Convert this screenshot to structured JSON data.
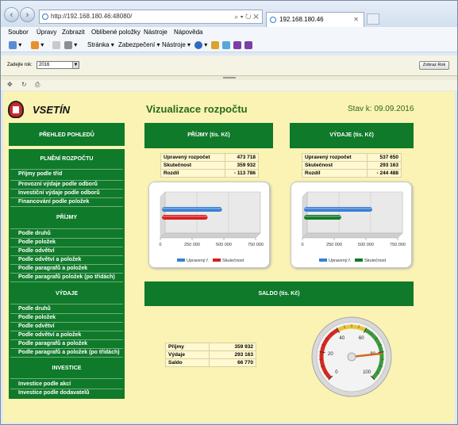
{
  "browser": {
    "address": "http://192.168.180.46:48080/",
    "address_tools": "⌕ ▾ ↻ ✕",
    "tab_title": "192.168.180.46",
    "menu": [
      "Soubor",
      "Úpravy",
      "Zobrazit",
      "Oblíbené položky",
      "Nástroje",
      "Nápověda"
    ],
    "commands": [
      "Stránka ▾",
      "Zabezpečení ▾",
      "Nástroje ▾"
    ]
  },
  "filter": {
    "label": "Zadejte rok:",
    "year": "2016",
    "button": "Zobraz Rok"
  },
  "header": {
    "town": "VSETÍN",
    "title": "Vizualizace rozpočtu",
    "stav": "Stav k: 09.09.2016"
  },
  "sidebar": {
    "head_prehled": "PŘEHLED POHLEDŮ",
    "head_plneni": "PLNĚNÍ ROZPOČTU",
    "plneni_items": [
      "Příjmy podle tříd",
      "Provozní výdaje podle odborů",
      "Investiční výdaje podle odborů",
      "Financování podle položek"
    ],
    "head_prijmy": "PŘÍJMY",
    "prijmy_items": [
      "Podle druhů",
      "Podle položek",
      "Podle odvětví",
      "Podle odvětví a položek",
      "Podle paragrafů a položek",
      "Podle paragrafů  položek (po třídách)"
    ],
    "head_vydaje": "VÝDAJE",
    "vydaje_items": [
      "Podle druhů",
      "Podle položek",
      "Podle odvětví",
      "Podle odvětví a položek",
      "Podle paragrafů a položek",
      "Podle paragrafů a položek (po třídách)"
    ],
    "head_investice": "INVESTICE",
    "investice_items": [
      "Investice podle akcí",
      "Investice podle dodavatelů"
    ]
  },
  "prijmy": {
    "title": "PŘÍJMY (tis. Kč)",
    "rows": [
      {
        "label": "Upravený rozpočet",
        "value": "473 718"
      },
      {
        "label": "Skutečnost",
        "value": "359 932"
      },
      {
        "label": "Rozdíl",
        "value": "- 113 786"
      }
    ]
  },
  "vydaje": {
    "title": "VÝDAJE (tis. Kč)",
    "rows": [
      {
        "label": "Upravený rozpočet",
        "value": "537 650"
      },
      {
        "label": "Skutečnost",
        "value": "293 163"
      },
      {
        "label": "Rozdíl",
        "value": "- 244 488"
      }
    ]
  },
  "saldo": {
    "title": "SALDO (tis. Kč)",
    "rows": [
      {
        "label": "Příjmy",
        "value": "359 932"
      },
      {
        "label": "Výdaje",
        "value": "293 163"
      },
      {
        "label": "Saldo",
        "value": "66 770"
      }
    ],
    "gauge": {
      "min": 0,
      "max": 100,
      "value": 81,
      "ticks": [
        "0",
        "20",
        "40",
        "60",
        "80",
        "100"
      ]
    }
  },
  "chart_data": [
    {
      "type": "bar",
      "categories": [
        ""
      ],
      "series": [
        {
          "name": "Upravený ř.",
          "values": [
            473718
          ],
          "color": "#3a7fd5"
        },
        {
          "name": "Skutečnost",
          "values": [
            359932
          ],
          "color": "#d81f1f"
        }
      ],
      "xlim": [
        0,
        750000
      ],
      "ticks": [
        "0",
        "250 000",
        "500 000",
        "750 000"
      ]
    },
    {
      "type": "bar",
      "categories": [
        ""
      ],
      "series": [
        {
          "name": "Upravený ř.",
          "values": [
            537650
          ],
          "color": "#3a7fd5"
        },
        {
          "name": "Skutečnost",
          "values": [
            293163
          ],
          "color": "#127a2a"
        }
      ],
      "xlim": [
        0,
        750000
      ],
      "ticks": [
        "0",
        "250 000",
        "500 000",
        "750 000"
      ]
    }
  ]
}
